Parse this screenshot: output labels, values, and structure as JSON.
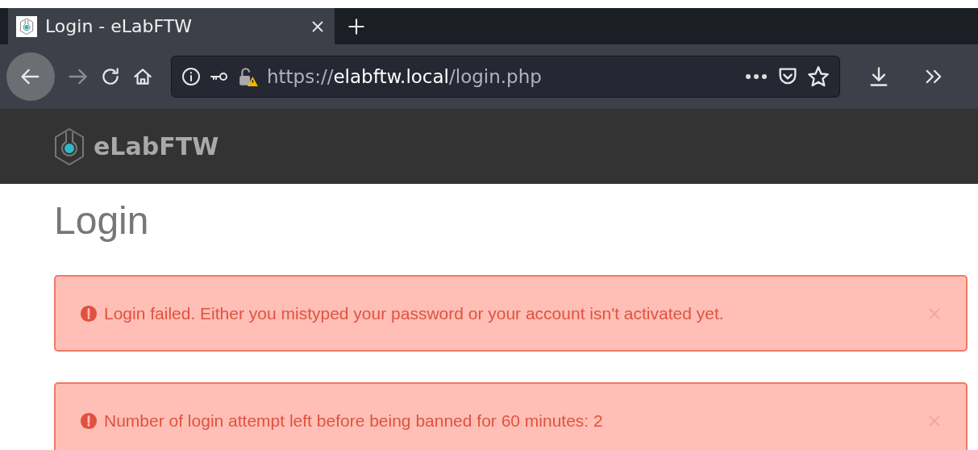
{
  "browser": {
    "tab": {
      "title": "Login - eLabFTW",
      "selected": true
    },
    "url": {
      "scheme": "https://",
      "host": "elabftw.local",
      "path": "/login.php"
    }
  },
  "site": {
    "brand": "eLabFTW"
  },
  "page": {
    "title": "Login"
  },
  "alerts": [
    {
      "kind": "error",
      "message": "Login failed. Either you mistyped your password or your account isn't activated yet."
    },
    {
      "kind": "error",
      "message": "Number of login attempt left before being banned for 60 minutes: 2"
    }
  ]
}
